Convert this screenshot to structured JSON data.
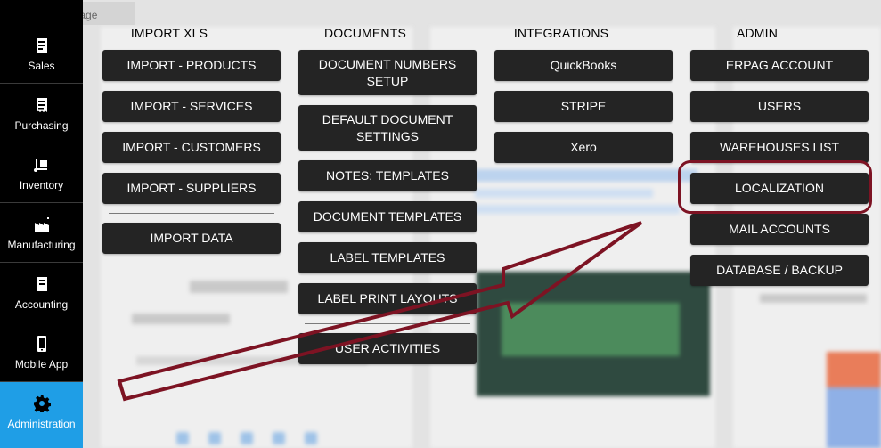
{
  "sidebar": {
    "items": [
      {
        "label": "Sales",
        "icon": "document-list-icon",
        "active": false
      },
      {
        "label": "Purchasing",
        "icon": "receipt-icon",
        "active": false
      },
      {
        "label": "Inventory",
        "icon": "hand-truck-icon",
        "active": false
      },
      {
        "label": "Manufacturing",
        "icon": "factory-icon",
        "active": false
      },
      {
        "label": "Accounting",
        "icon": "ledger-book-icon",
        "active": false
      },
      {
        "label": "Mobile App",
        "icon": "mobile-phone-icon",
        "active": false
      },
      {
        "label": "Administration",
        "icon": "gear-icon",
        "active": true
      }
    ]
  },
  "tab": {
    "label": "Home Page"
  },
  "menu": {
    "columns": [
      {
        "title": "IMPORT XLS",
        "items": [
          "IMPORT - PRODUCTS",
          "IMPORT - SERVICES",
          "IMPORT - CUSTOMERS",
          "IMPORT - SUPPLIERS",
          "IMPORT DATA"
        ]
      },
      {
        "title": "DOCUMENTS",
        "items": [
          "DOCUMENT NUMBERS SETUP",
          "DEFAULT DOCUMENT SETTINGS",
          "NOTES: TEMPLATES",
          "DOCUMENT TEMPLATES",
          "LABEL TEMPLATES",
          "LABEL PRINT LAYOUTS",
          "USER ACTIVITIES"
        ]
      },
      {
        "title": "INTEGRATIONS",
        "items": [
          "QuickBooks",
          "STRIPE",
          "Xero"
        ]
      },
      {
        "title": "ADMIN",
        "items": [
          "ERPAG ACCOUNT",
          "USERS",
          "WAREHOUSES LIST",
          "LOCALIZATION",
          "MAIL ACCOUNTS",
          "DATABASE / BACKUP"
        ]
      }
    ]
  },
  "annotation": {
    "highlight_color": "#7d1323",
    "target": "LOCALIZATION"
  },
  "colors": {
    "sidebar_bg": "#000000",
    "sidebar_active": "#1f9ee6",
    "button_bg": "#242424"
  }
}
